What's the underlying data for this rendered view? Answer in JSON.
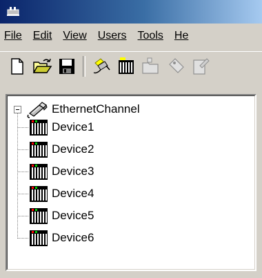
{
  "window": {
    "title": ""
  },
  "menubar": {
    "items": [
      {
        "label": "File"
      },
      {
        "label": "Edit"
      },
      {
        "label": "View"
      },
      {
        "label": "Users"
      },
      {
        "label": "Tools"
      },
      {
        "label": "He"
      }
    ]
  },
  "toolbar": {
    "icons": [
      "new-document-icon",
      "open-folder-icon",
      "save-icon",
      "new-channel-icon",
      "new-device-icon",
      "new-group-icon",
      "new-tag-icon",
      "properties-icon"
    ]
  },
  "tree": {
    "channel": {
      "label": "EthernetChannel",
      "expanded": true
    },
    "devices": [
      {
        "label": "Device1"
      },
      {
        "label": "Device2"
      },
      {
        "label": "Device3"
      },
      {
        "label": "Device4"
      },
      {
        "label": "Device5"
      },
      {
        "label": "Device6"
      }
    ]
  }
}
